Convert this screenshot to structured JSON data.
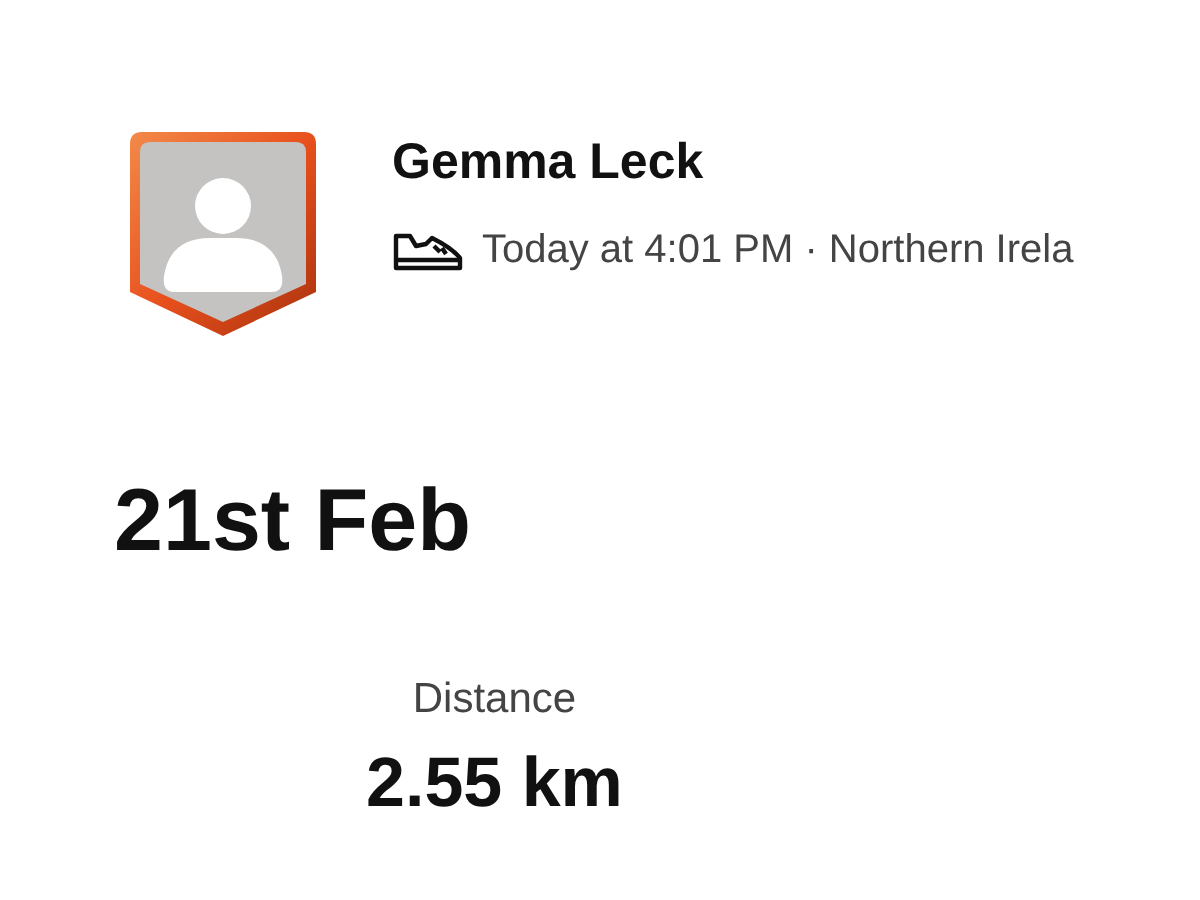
{
  "athlete": {
    "name": "Gemma Leck",
    "subtitle": "Today at 4:01 PM · Northern Irela"
  },
  "activity": {
    "date": "21st Feb"
  },
  "stats": [
    {
      "label": "Distance",
      "value": "2.55 km"
    }
  ]
}
